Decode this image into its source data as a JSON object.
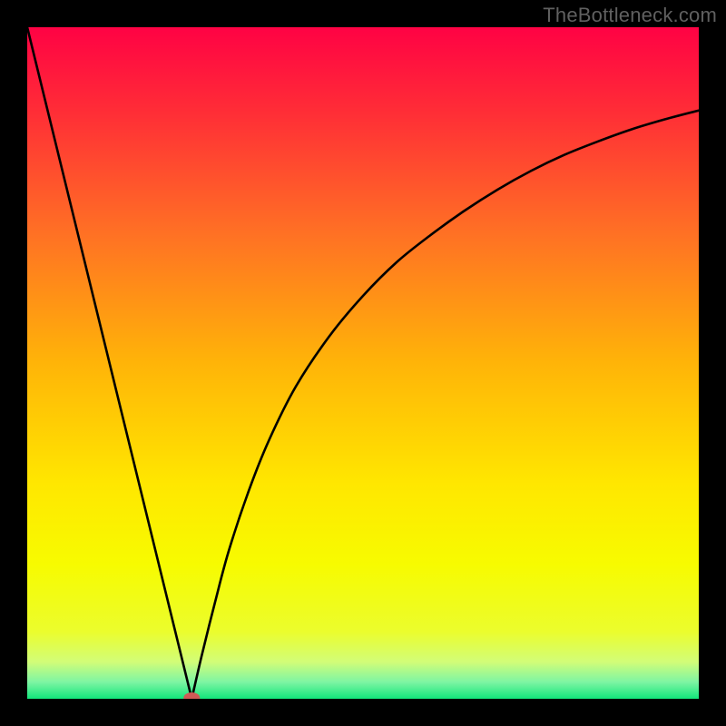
{
  "watermark": {
    "text": "TheBottleneck.com"
  },
  "chart_data": {
    "type": "line",
    "title": "",
    "xlabel": "",
    "ylabel": "",
    "xlim": [
      0,
      100
    ],
    "ylim": [
      0,
      100
    ],
    "grid": false,
    "legend": false,
    "background_gradient_stops": [
      {
        "offset": 0.0,
        "color": "#ff0244"
      },
      {
        "offset": 0.12,
        "color": "#ff2b37"
      },
      {
        "offset": 0.3,
        "color": "#ff6e25"
      },
      {
        "offset": 0.5,
        "color": "#ffb408"
      },
      {
        "offset": 0.68,
        "color": "#ffe700"
      },
      {
        "offset": 0.8,
        "color": "#f7fb00"
      },
      {
        "offset": 0.9,
        "color": "#ebfd2d"
      },
      {
        "offset": 0.945,
        "color": "#d2fd78"
      },
      {
        "offset": 0.975,
        "color": "#7ef5a3"
      },
      {
        "offset": 1.0,
        "color": "#12e57b"
      }
    ],
    "series": [
      {
        "name": "left-segment",
        "kind": "line",
        "x": [
          0,
          24.5
        ],
        "y": [
          100,
          0
        ]
      },
      {
        "name": "right-curve",
        "kind": "curve",
        "x": [
          24.5,
          26,
          28,
          30,
          33,
          36,
          40,
          45,
          50,
          55,
          60,
          65,
          70,
          75,
          80,
          85,
          90,
          95,
          100
        ],
        "y": [
          0,
          6.5,
          14.5,
          22,
          31,
          38.5,
          46.5,
          54,
          60,
          65,
          69,
          72.6,
          75.8,
          78.6,
          81,
          83,
          84.8,
          86.3,
          87.6
        ]
      }
    ],
    "marker": {
      "name": "ideal-point",
      "x": 24.5,
      "y": 0,
      "color": "#cf5a56",
      "rx": 9,
      "ry": 6
    }
  }
}
